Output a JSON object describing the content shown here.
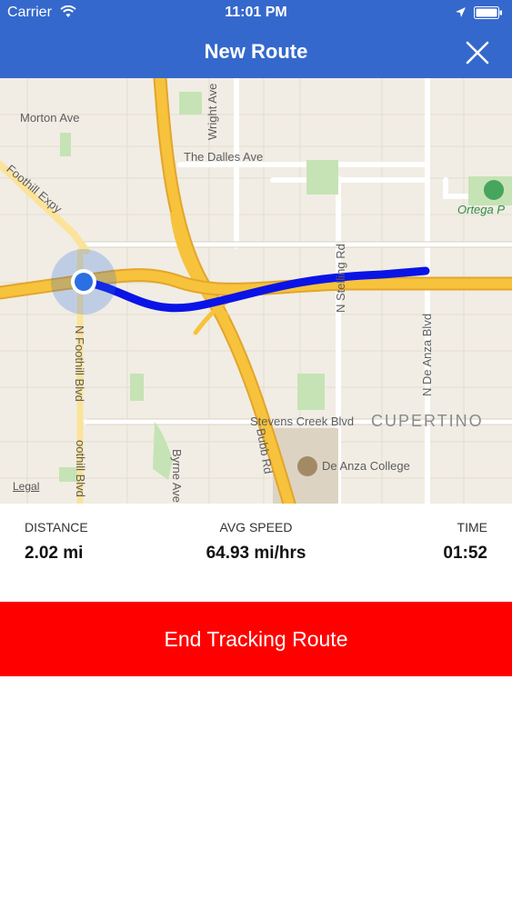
{
  "status_bar": {
    "carrier": "Carrier",
    "time": "11:01 PM"
  },
  "nav": {
    "title": "New Route",
    "close_icon": "close-icon"
  },
  "map": {
    "labels": {
      "morton": "Morton Ave",
      "foothill_expy": "Foothill Expy",
      "wright": "Wright Ave",
      "dalles": "The Dalles Ave",
      "ortega": "Ortega P",
      "stelling": "N Stelling Rd",
      "de_anza": "N De Anza Blvd",
      "n_foothill": "N Foothill Blvd",
      "stevens": "Stevens Creek Blvd",
      "cupertino": "CUPERTINO",
      "college": "De Anza College",
      "byrne": "Byrne Ave",
      "bubb": "Bubb Rd",
      "foothill_low": "oothill Blvd"
    },
    "legal": "Legal",
    "colors": {
      "route": "#0a14e6",
      "highway": "#f7c23c",
      "location_dot": "#2b6fe4"
    }
  },
  "stats": {
    "distance_label": "DISTANCE",
    "distance_value": "2.02 mi",
    "speed_label": "AVG SPEED",
    "speed_value": "64.93 mi/hrs",
    "time_label": "TIME",
    "time_value": "01:52"
  },
  "action": {
    "end_label": "End Tracking Route",
    "color": "#ff0000"
  }
}
